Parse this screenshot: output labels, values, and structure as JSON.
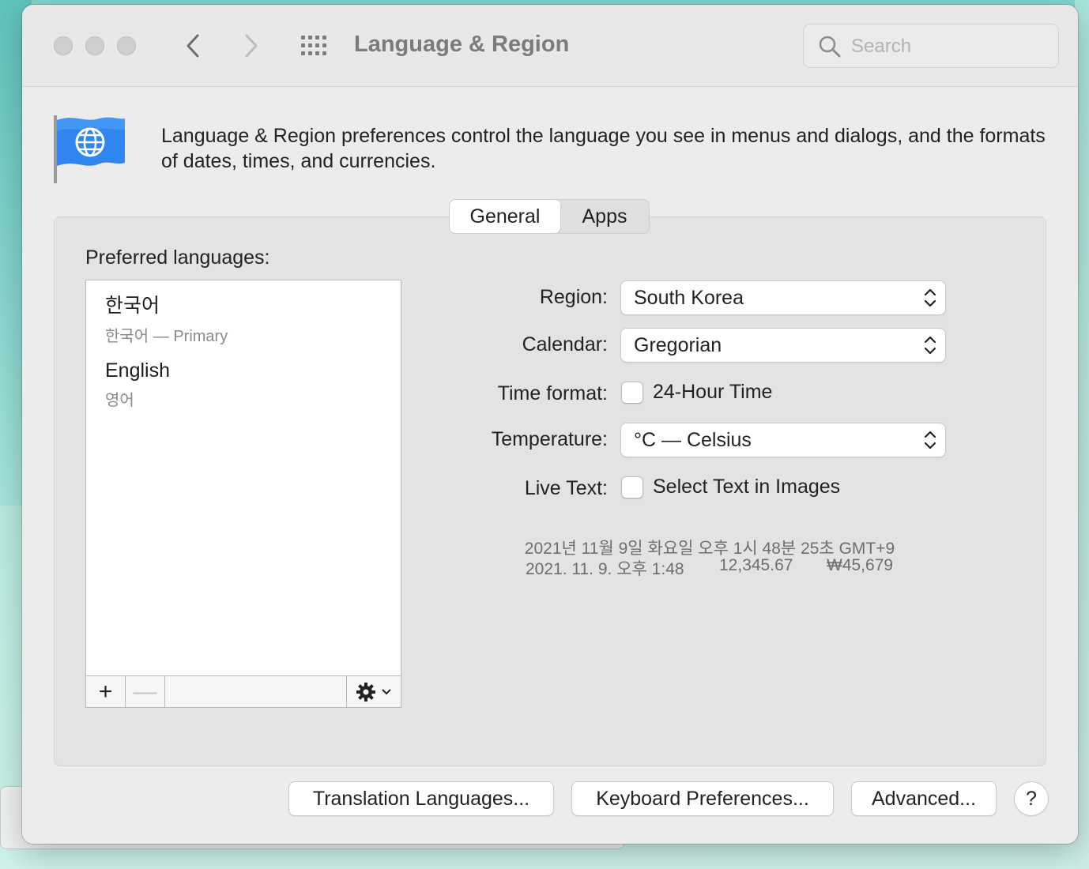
{
  "window": {
    "title": "Language & Region",
    "search_placeholder": "Search"
  },
  "description": "Language & Region preferences control the language you see in menus and dialogs, and the formats of dates, times, and currencies.",
  "tabs": [
    {
      "label": "General",
      "active": true
    },
    {
      "label": "Apps",
      "active": false
    }
  ],
  "preferred_languages": {
    "label": "Preferred languages:",
    "items": [
      {
        "name": "한국어",
        "subtitle": "한국어 — Primary"
      },
      {
        "name": "English",
        "subtitle": "영어"
      }
    ],
    "toolbar": {
      "add": "+",
      "remove": "—"
    }
  },
  "settings": {
    "region": {
      "label": "Region:",
      "value": "South Korea"
    },
    "calendar": {
      "label": "Calendar:",
      "value": "Gregorian"
    },
    "time_format": {
      "label": "Time format:",
      "checkbox_label": "24-Hour Time",
      "checked": false
    },
    "temperature": {
      "label": "Temperature:",
      "value": "°C — Celsius"
    },
    "live_text": {
      "label": "Live Text:",
      "checkbox_label": "Select Text in Images",
      "checked": false
    }
  },
  "samples": {
    "full_date": "2021년 11월 9일 화요일 오후 1시 48분 25초 GMT+9",
    "short_date": "2021. 11. 9. 오후 1:48",
    "number": "12,345.67",
    "currency": "₩45,679"
  },
  "buttons": {
    "translation": "Translation Languages...",
    "keyboard": "Keyboard Preferences...",
    "advanced": "Advanced...",
    "help": "?"
  },
  "colors": {
    "flag_blue": "#2f86f0",
    "window_bg": "#ececec",
    "panel_bg": "#e3e3e3"
  }
}
